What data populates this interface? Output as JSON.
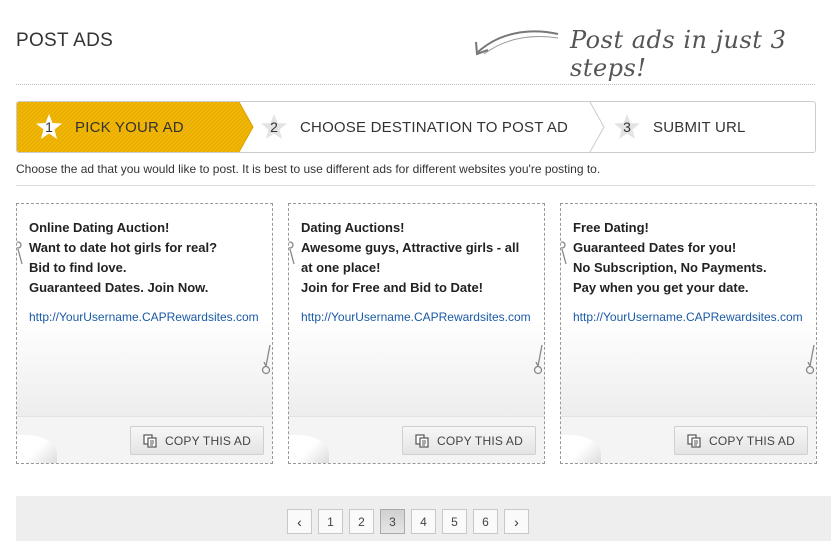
{
  "header": {
    "title": "POST ADS",
    "tagline": "Post ads in just 3 steps!"
  },
  "steps": [
    {
      "number": "1",
      "label": "PICK YOUR AD",
      "active": true
    },
    {
      "number": "2",
      "label": "CHOOSE DESTINATION TO POST AD",
      "active": false
    },
    {
      "number": "3",
      "label": "SUBMIT URL",
      "active": false
    }
  ],
  "instructions": "Choose the ad that you would like to post. It is best to use different ads for different websites you're posting to.",
  "ads": [
    {
      "lines": [
        "Online Dating Auction!",
        "Want to date hot girls for real?",
        "Bid to find love.",
        "Guaranteed Dates. Join Now."
      ],
      "link": "http://YourUsername.CAPRewardsites.com",
      "button": "COPY THIS AD"
    },
    {
      "lines": [
        "Dating Auctions!",
        "Awesome guys, Attractive girls - all",
        "at one place!",
        "Join for Free and Bid to Date!"
      ],
      "link": "http://YourUsername.CAPRewardsites.com",
      "button": "COPY THIS AD"
    },
    {
      "lines": [
        "Free Dating!",
        "Guaranteed Dates for you!",
        "No Subscription, No Payments.",
        "Pay when you get your date."
      ],
      "link": "http://YourUsername.CAPRewardsites.com",
      "button": "COPY THIS AD"
    }
  ],
  "pagination": {
    "prev": "‹",
    "pages": [
      "1",
      "2",
      "3",
      "4",
      "5",
      "6"
    ],
    "current": "3",
    "next": "›"
  },
  "colors": {
    "active_step": "#f2b705",
    "link": "#1a5aa8"
  },
  "icons": {
    "step_badge": "star-icon",
    "copy": "copy-icon",
    "cut_marks": "scissors-icon",
    "tagline_arrow": "curved-arrow-icon"
  }
}
